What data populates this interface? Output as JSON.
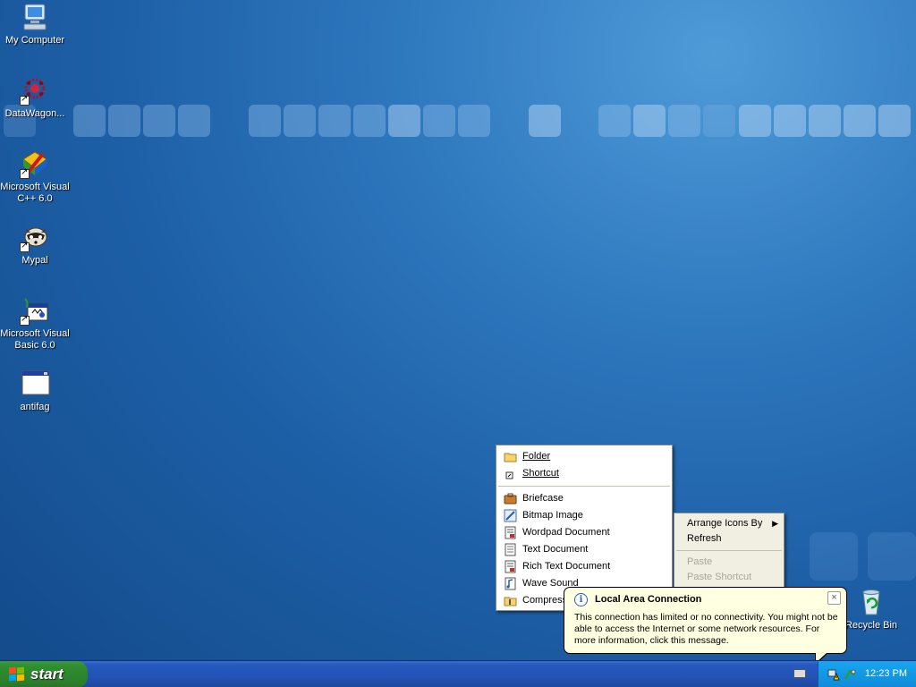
{
  "desktop": {
    "icons": [
      {
        "label": "My Computer",
        "icon": "computer-icon"
      },
      {
        "label": "DataWagon...",
        "icon": "datawagon-icon"
      },
      {
        "label": "Microsoft Visual C++ 6.0",
        "icon": "visual-cpp-icon"
      },
      {
        "label": "Mypal",
        "icon": "mypal-raccoon-icon"
      },
      {
        "label": "Microsoft Visual Basic 6.0",
        "icon": "visual-basic-icon"
      },
      {
        "label": "antifag",
        "icon": "window-icon"
      },
      {
        "label": "Recycle Bin",
        "icon": "recycle-bin-icon"
      }
    ]
  },
  "new_submenu": {
    "items": [
      {
        "label": "Folder",
        "icon": "folder-icon"
      },
      {
        "label": "Shortcut",
        "icon": "shortcut-icon"
      },
      {
        "label": "Briefcase",
        "icon": "briefcase-icon"
      },
      {
        "label": "Bitmap Image",
        "icon": "bitmap-icon"
      },
      {
        "label": "Wordpad Document",
        "icon": "wordpad-icon"
      },
      {
        "label": "Text Document",
        "icon": "text-document-icon"
      },
      {
        "label": "Rich Text Document",
        "icon": "rich-text-icon"
      },
      {
        "label": "Wave Sound",
        "icon": "wave-sound-icon"
      },
      {
        "label": "Compress",
        "icon": "compressed-folder-icon"
      }
    ]
  },
  "desktop_menu": {
    "items": [
      {
        "label": "Arrange Icons By",
        "has_submenu": true
      },
      {
        "label": "Refresh"
      },
      {
        "label": "Paste",
        "disabled": true
      },
      {
        "label": "Paste Shortcut",
        "disabled": true
      }
    ]
  },
  "balloon": {
    "title": "Local Area Connection",
    "body": "This connection has limited or no connectivity. You might not be able to access the Internet or some network resources. For more information, click this message.",
    "close_glyph": "×"
  },
  "taskbar": {
    "start_label": "start",
    "clock": "12:23 PM"
  }
}
